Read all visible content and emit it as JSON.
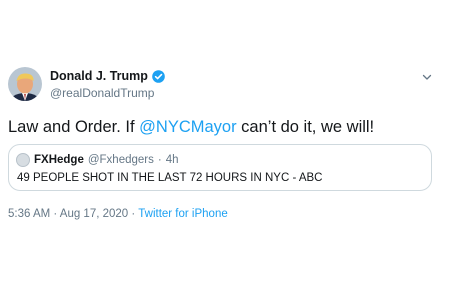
{
  "author": {
    "name": "Donald J. Trump",
    "handle": "@realDonaldTrump"
  },
  "icons": {
    "verified": "verified-badge-icon",
    "more": "chevron-down-icon",
    "avatar": "profile-photo"
  },
  "tweet": {
    "text_before": "Law and Order. If ",
    "mention": "@NYCMayor",
    "text_after": " can’t do it, we will!"
  },
  "quote": {
    "name": "FXHedge",
    "handle": "@Fxhedgers",
    "separator": "·",
    "time": "4h",
    "text": "49 PEOPLE SHOT IN THE LAST 72 HOURS IN NYC - ABC"
  },
  "footer": {
    "timestamp": "5:36 AM · Aug 17, 2020",
    "separator": "·",
    "source": "Twitter for iPhone"
  },
  "colors": {
    "link": "#1da1f2",
    "secondary_text": "#657786",
    "primary_text": "#14171a",
    "border": "#cfd9de"
  }
}
